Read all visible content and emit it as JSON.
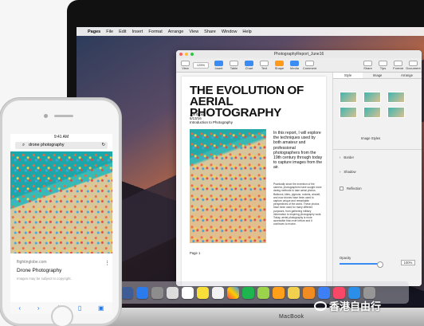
{
  "mac": {
    "model": "MacBook",
    "menu": [
      "Pages",
      "File",
      "Edit",
      "Insert",
      "Format",
      "Arrange",
      "View",
      "Share",
      "Window",
      "Help"
    ]
  },
  "window": {
    "title": "PhotographyReport_June16",
    "zoom": "125%",
    "tools": [
      "View",
      "Zoom",
      "Insert",
      "Table",
      "Chart",
      "Text",
      "Shape",
      "Media",
      "Comment",
      "Share",
      "Tips",
      "Format",
      "Document"
    ]
  },
  "document": {
    "headline": "THE EVOLUTION OF\nAERIAL PHOTOGRAPHY",
    "author": "Jon Blood",
    "date": "6/13/16",
    "intro_title": "Introduction to Photography",
    "body_large": "In this report, I will explore the techniques used by both amateur and professional photographers from the 19th century through today to capture images from the air.",
    "body_small": "Practically since the invention of the camera, photographers have sought more daring methods to take aerial photos. Balloons, kites, pigeons, rockets, aircraft, and now drones have been used to capture unique and remarkable perspectives of the world. These photos have been used for many different purposes, from gathering military information to inspiring photography work. Today, aerial photography is more accessible than ever before and it continues to evolve.",
    "page": "Page 1"
  },
  "inspector": {
    "tabs": [
      "Style",
      "Image",
      "Arrange"
    ],
    "styles_label": "Image Styles",
    "border": "Border",
    "shadow": "Shadow",
    "reflection": "Reflection",
    "opacity": "Opacity",
    "opacity_value": "100%"
  },
  "iphone": {
    "time": "9:41 AM",
    "search": "drone photography",
    "site": "flightinglobe.com",
    "result_title": "Drone Photography",
    "result_note": "Images may be subject to copyright."
  },
  "watermark": "香港自由行",
  "colors": {
    "accent": "#3a8bf2",
    "screen_bg": "#b86745"
  }
}
